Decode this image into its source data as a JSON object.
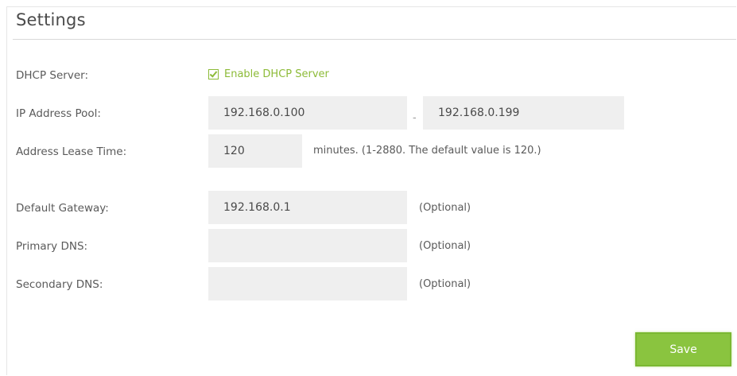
{
  "header": {
    "title": "Settings"
  },
  "form": {
    "dhcp_server": {
      "label": "DHCP Server:",
      "checkbox_label": "Enable DHCP Server",
      "checked": true
    },
    "ip_pool": {
      "label": "IP Address Pool:",
      "start": "192.168.0.100",
      "separator": "-",
      "end": "192.168.0.199"
    },
    "lease_time": {
      "label": "Address Lease Time:",
      "value": "120",
      "hint": "minutes. (1-2880. The default value is 120.)"
    },
    "gateway": {
      "label": "Default Gateway:",
      "value": "192.168.0.1",
      "hint": "(Optional)"
    },
    "primary_dns": {
      "label": "Primary DNS:",
      "value": "",
      "hint": "(Optional)"
    },
    "secondary_dns": {
      "label": "Secondary DNS:",
      "value": "",
      "hint": "(Optional)"
    }
  },
  "actions": {
    "save_label": "Save"
  },
  "colors": {
    "accent": "#8ac43f",
    "field_bg": "#efefef"
  }
}
